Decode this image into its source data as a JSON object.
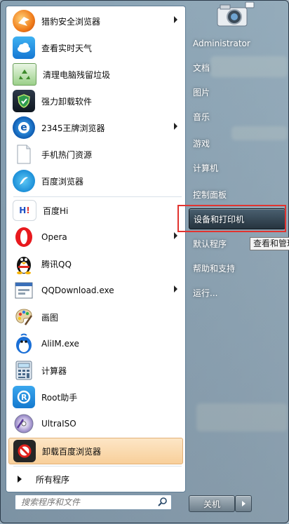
{
  "programs": [
    {
      "label": "猎豹安全浏览器",
      "icon": "cheetah-browser-icon",
      "submenu": true
    },
    {
      "label": "查看实时天气",
      "icon": "weather-icon",
      "submenu": false
    },
    {
      "label": "清理电脑残留垃圾",
      "icon": "recycle-icon",
      "submenu": false
    },
    {
      "label": "强力卸载软件",
      "icon": "uninstall-shield-icon",
      "submenu": false
    },
    {
      "label": "2345王牌浏览器",
      "icon": "browser-2345-icon",
      "submenu": true
    },
    {
      "label": "手机热门资源",
      "icon": "document-icon",
      "submenu": false
    },
    {
      "label": "百度浏览器",
      "icon": "baidu-browser-icon",
      "submenu": false
    },
    {
      "label": "百度Hi",
      "icon": "baidu-hi-icon",
      "submenu": false
    },
    {
      "label": "Opera",
      "icon": "opera-icon",
      "submenu": true
    },
    {
      "label": "腾讯QQ",
      "icon": "qq-penguin-icon",
      "submenu": false
    },
    {
      "label": "QQDownload.exe",
      "icon": "qqdownload-icon",
      "submenu": true
    },
    {
      "label": "画图",
      "icon": "paint-palette-icon",
      "submenu": false
    },
    {
      "label": "AliIM.exe",
      "icon": "aliim-icon",
      "submenu": false
    },
    {
      "label": "计算器",
      "icon": "calculator-icon",
      "submenu": false
    },
    {
      "label": "Root助手",
      "icon": "root-assistant-icon",
      "submenu": false
    },
    {
      "label": "UltraISO",
      "icon": "ultraiso-disc-icon",
      "submenu": false
    },
    {
      "label": "卸载百度浏览器",
      "icon": "uninstall-baidu-icon",
      "submenu": false,
      "selected": true
    }
  ],
  "all_programs": "所有程序",
  "search": {
    "placeholder": "搜索程序和文件"
  },
  "right": {
    "items": [
      {
        "label": "Administrator"
      },
      {
        "label": "文档"
      },
      {
        "label": "图片"
      },
      {
        "label": "音乐"
      },
      {
        "label": "游戏"
      },
      {
        "label": "计算机"
      },
      {
        "label": "控制面板"
      },
      {
        "label": "设备和打印机",
        "highlighted": true
      },
      {
        "label": "默认程序"
      },
      {
        "label": "帮助和支持"
      },
      {
        "label": "运行..."
      }
    ],
    "tooltip": "查看和管理"
  },
  "shutdown": {
    "label": "关机"
  },
  "colors": {
    "highlight_border": "#e2332f",
    "selected_bg": "#f8cf9a"
  }
}
